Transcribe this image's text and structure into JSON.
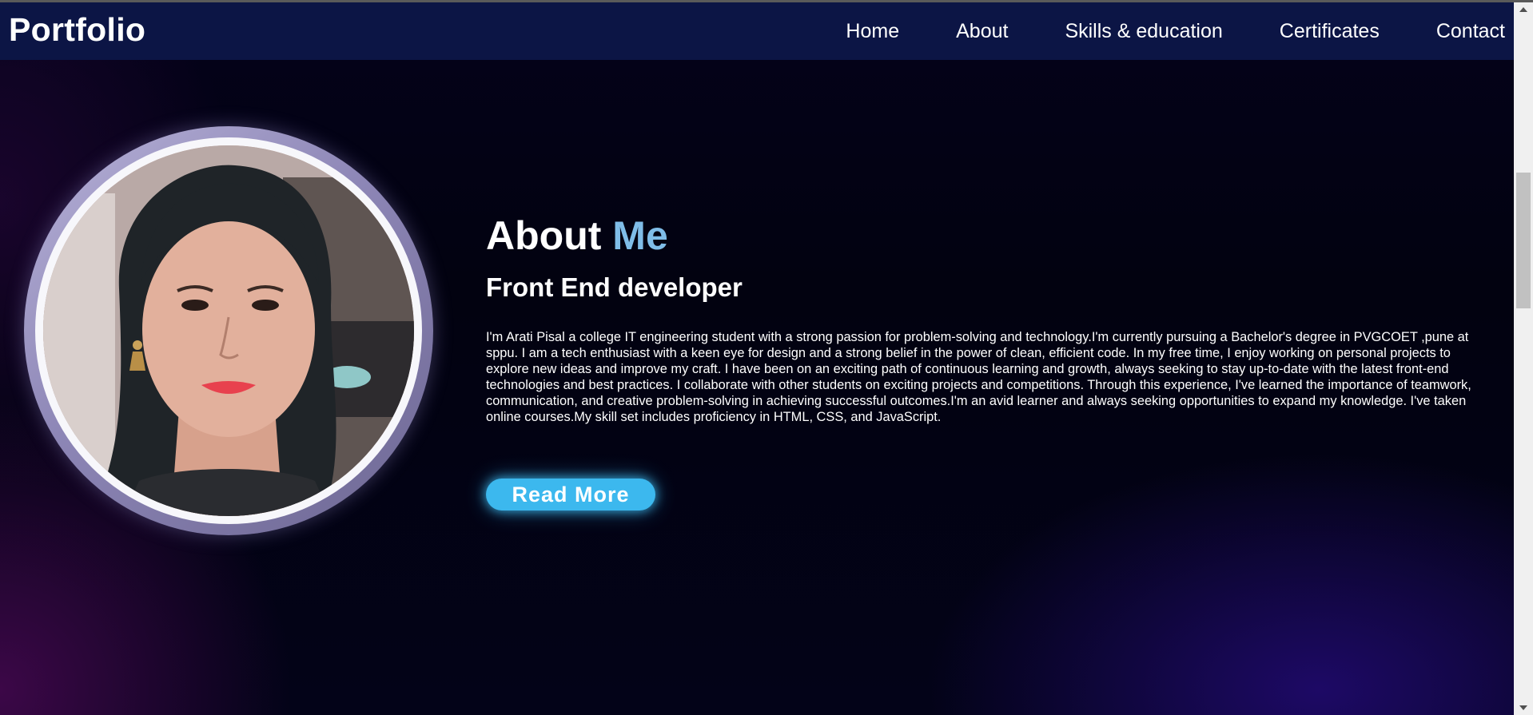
{
  "navbar": {
    "logo": "Portfolio",
    "links": [
      "Home",
      "About",
      "Skills & education",
      "Certificates",
      "Contact"
    ]
  },
  "about": {
    "heading_main": "About",
    "heading_accent": "Me",
    "role": "Front End developer",
    "bio": "I'm Arati Pisal a college IT engineering student with a strong passion for problem-solving and technology.I'm currently pursuing a Bachelor's degree in PVGCOET ,pune at sppu. I am a tech enthusiast with a keen eye for design and a strong belief in the power of clean, efficient code. In my free time, I enjoy working on personal projects to explore new ideas and improve my craft. I have been on an exciting path of continuous learning and growth, always seeking to stay up-to-date with the latest front-end technologies and best practices. I collaborate with other students on exciting projects and competitions. Through this experience, I've learned the importance of teamwork, communication, and creative problem-solving in achieving successful outcomes.I'm an avid learner and always seeking opportunities to expand my knowledge. I've taken online courses.My skill set includes proficiency in HTML, CSS, and JavaScript.",
    "read_more_label": "Read More"
  },
  "colors": {
    "navbar_bg": "#0c1545",
    "accent": "#7fbde8",
    "button": "#3cb8ee",
    "text": "#ffffff"
  },
  "icons": {
    "scroll_up": "chevron-up-icon",
    "scroll_down": "chevron-down-icon"
  }
}
